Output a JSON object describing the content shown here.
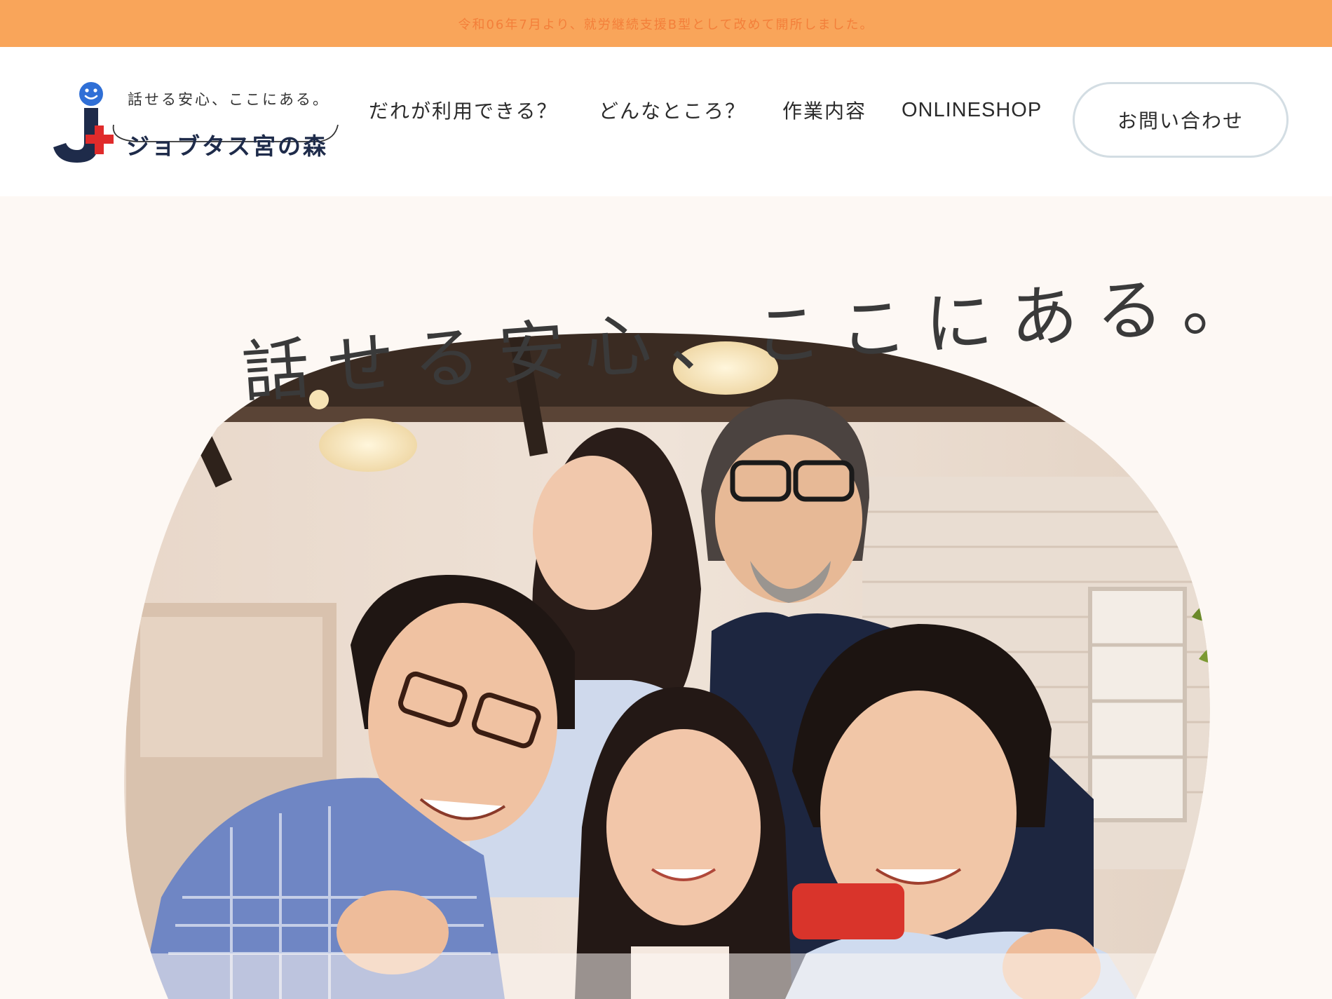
{
  "announcement": {
    "text": "令和06年7月より、就労継続支援B型として改めて開所しました。"
  },
  "header": {
    "logo": {
      "tagline": "話せる安心、ここにある。",
      "name": "ジョブタス宮の森",
      "mark_letter": "J",
      "icon": "smiley-plus-logo-icon"
    },
    "nav": [
      {
        "label": "だれが利用できる？"
      },
      {
        "label": "どんなところ？"
      },
      {
        "label": "作業内容"
      },
      {
        "label": "ONLINESHOP"
      }
    ],
    "contact_label": "お問い合わせ"
  },
  "hero": {
    "heading": "話せる安心、ここにある。",
    "photo": "group-photo-five-people-smiling"
  },
  "colors": {
    "announce_bg": "#f9a55a",
    "announce_text": "#f37f3a",
    "logo_navy": "#1e2b4a",
    "logo_red": "#e02b2b",
    "logo_blue": "#2f6fd6",
    "hero_bg": "#fdf8f4",
    "button_border": "#d3dde3"
  }
}
